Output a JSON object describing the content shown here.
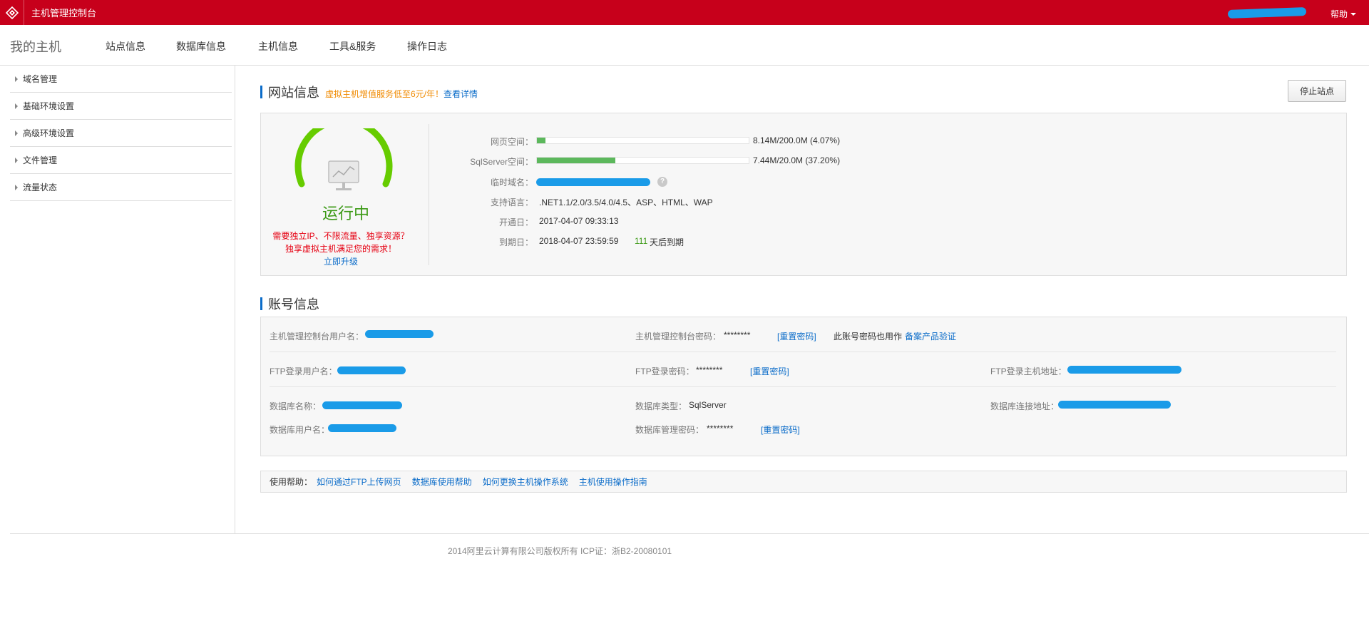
{
  "topbar": {
    "title": "主机管理控制台",
    "help": "帮助"
  },
  "navbar": {
    "brand": "我的主机",
    "items": [
      "站点信息",
      "数据库信息",
      "主机信息",
      "工具&服务",
      "操作日志"
    ]
  },
  "sidebar": {
    "items": [
      "域名管理",
      "基础环境设置",
      "高级环境设置",
      "文件管理",
      "流量状态"
    ]
  },
  "site_info": {
    "title": "网站信息",
    "promo": "虚拟主机增值服务低至6元/年！",
    "promo_link": "查看详情",
    "stop_button": "停止站点",
    "status": "运行中",
    "upsell_line1": "需要独立IP、不限流量、独享资源？",
    "upsell_line2": "独享虚拟主机满足您的需求！",
    "upgrade_link": "立即升级",
    "web_space_label": "网页空间：",
    "web_space_value": "8.14M/200.0M (4.07%)",
    "web_space_percent": 4.07,
    "sql_space_label": "SqlServer空间：",
    "sql_space_value": "7.44M/20.0M (37.20%)",
    "sql_space_percent": 37.2,
    "temp_domain_label": "临时域名：",
    "languages_label": "支持语言：",
    "languages_value": ".NET1.1/2.0/3.5/4.0/4.5、ASP、HTML、WAP",
    "open_date_label": "开通日：",
    "open_date_value": "2017-04-07 09:33:13",
    "expire_label": "到期日：",
    "expire_value": "2018-04-07 23:59:59",
    "days_left": "111",
    "days_left_suffix": "天后到期"
  },
  "account_info": {
    "title": "账号信息",
    "console_user_label": "主机管理控制台用户名：",
    "console_pwd_label": "主机管理控制台密码：",
    "console_pwd_value": "********",
    "reset_pwd": "[重置密码]",
    "console_pwd_note": "此账号密码也用作",
    "console_pwd_note_link": "备案产品验证",
    "ftp_user_label": "FTP登录用户名：",
    "ftp_pwd_label": "FTP登录密码：",
    "ftp_pwd_value": "********",
    "ftp_host_label": "FTP登录主机地址：",
    "db_name_label": "数据库名称：",
    "db_type_label": "数据库类型：",
    "db_type_value": "SqlServer",
    "db_host_label": "数据库连接地址：",
    "db_user_label": "数据库用户名：",
    "db_pwd_label": "数据库管理密码：",
    "db_pwd_value": "********"
  },
  "help_bar": {
    "label": "使用帮助：",
    "links": [
      "如何通过FTP上传网页",
      "数据库使用帮助",
      "如何更换主机操作系统",
      "主机使用操作指南"
    ]
  },
  "footer": {
    "text": "2014阿里云计算有限公司版权所有 ICP证：浙B2-20080101"
  },
  "colors": {
    "topbar": "#c7001b",
    "link": "#0b6cc9",
    "status_green": "#3c9a16",
    "progress_green": "#5cb85c",
    "promo_orange": "#f08a00",
    "warning_red": "#e60012"
  }
}
